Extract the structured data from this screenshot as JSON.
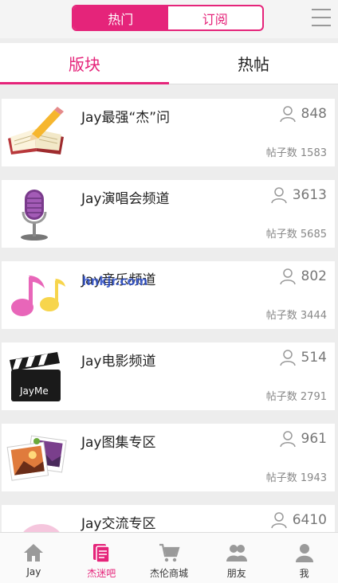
{
  "header": {
    "segments": [
      {
        "label": "热门",
        "active": true
      },
      {
        "label": "订阅",
        "active": false
      }
    ],
    "menu_icon": "hamburger-menu-icon"
  },
  "subtabs": [
    {
      "label": "版块",
      "active": true
    },
    {
      "label": "热帖",
      "active": false
    }
  ],
  "forums": [
    {
      "title": "Jay最强“杰”问",
      "members": "848",
      "posts_label": "帖子数 1583",
      "icon": "open-book-pencil-icon"
    },
    {
      "title": "Jay演唱会频道",
      "members": "3613",
      "posts_label": "帖子数 5685",
      "icon": "microphone-icon"
    },
    {
      "title": "Jay音乐频道",
      "members": "802",
      "posts_label": "帖子数 3444",
      "icon": "music-notes-icon"
    },
    {
      "title": "Jay电影频道",
      "members": "514",
      "posts_label": "帖子数 2791",
      "icon": "clapperboard-icon"
    },
    {
      "title": "Jay图集专区",
      "members": "961",
      "posts_label": "帖子数 1943",
      "icon": "photos-icon"
    },
    {
      "title": "Jay交流专区",
      "members": "6410",
      "posts_label": "",
      "icon": "chat-bubble-icon"
    }
  ],
  "clapper_text": "JayMe",
  "watermark": "hnkjr.com",
  "bottom_nav": [
    {
      "label": "Jay",
      "icon": "home-icon",
      "active": false
    },
    {
      "label": "杰迷吧",
      "icon": "forum-icon",
      "active": true
    },
    {
      "label": "杰伦商城",
      "icon": "cart-icon",
      "active": false
    },
    {
      "label": "朋友",
      "icon": "friends-icon",
      "active": false
    },
    {
      "label": "我",
      "icon": "profile-icon",
      "active": false
    }
  ],
  "colors": {
    "accent": "#e5247a",
    "background": "#ededed"
  }
}
